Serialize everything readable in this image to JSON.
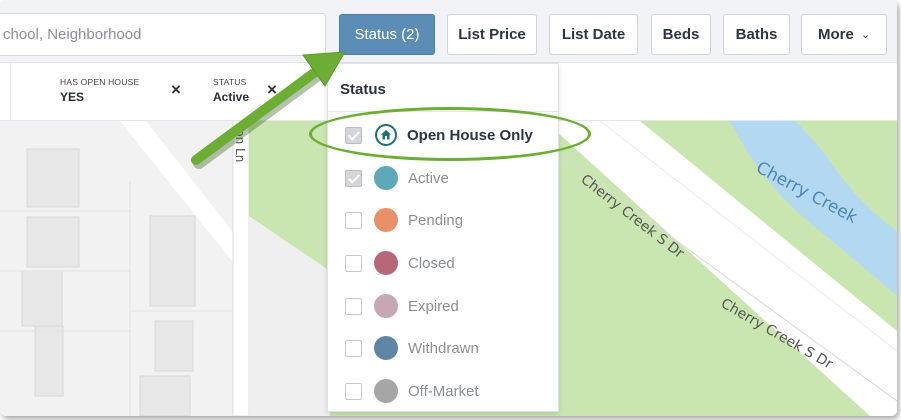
{
  "search": {
    "placeholder": "chool, Neighborhood"
  },
  "filters": {
    "status": "Status (2)",
    "list_price": "List Price",
    "list_date": "List Date",
    "beds": "Beds",
    "baths": "Baths",
    "more": "More"
  },
  "chips": [
    {
      "label": "HAS OPEN HOUSE",
      "value": "YES"
    },
    {
      "label": "STATUS",
      "value": "Active"
    }
  ],
  "dropdown": {
    "title": "Status",
    "options": [
      {
        "label": "Open House Only",
        "checked": true,
        "color": "#1f6f78",
        "icon": "home-icon"
      },
      {
        "label": "Active",
        "checked": true,
        "color": "#5ea9b8"
      },
      {
        "label": "Pending",
        "checked": false,
        "color": "#e8906a"
      },
      {
        "label": "Closed",
        "checked": false,
        "color": "#b66779"
      },
      {
        "label": "Expired",
        "checked": false,
        "color": "#c7a6b6"
      },
      {
        "label": "Withdrawn",
        "checked": false,
        "color": "#5f86a4"
      },
      {
        "label": "Off-Market",
        "checked": false,
        "color": "#a6a6a6"
      }
    ]
  },
  "map": {
    "labels": {
      "creek": "Cherry Creek",
      "road1": "Cherry Creek S Dr",
      "road2": "Cherry Creek S Dr",
      "lane": "son Ln"
    }
  },
  "colors": {
    "accent": "#5b8db6",
    "highlight": "#6cae34",
    "park": "#c9e6b0",
    "water": "#b3d9f2"
  }
}
